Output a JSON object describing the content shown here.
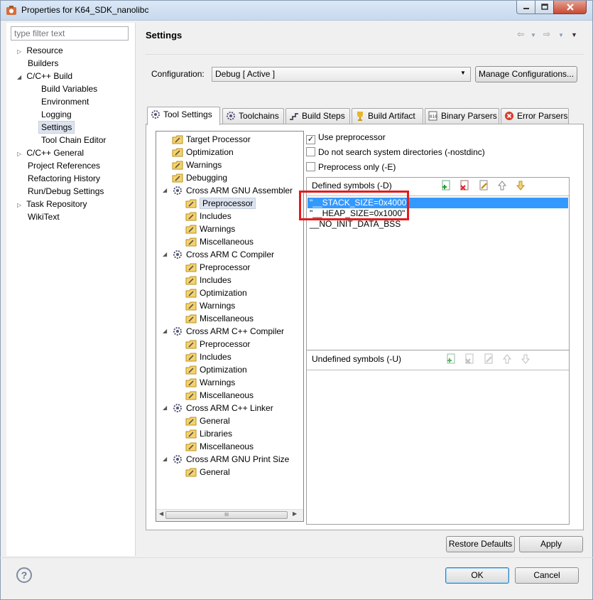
{
  "window": {
    "title": "Properties for K64_SDK_nanolibc"
  },
  "filter": {
    "placeholder": "type filter text"
  },
  "nav": [
    {
      "label": "Resource",
      "twisty": "▷"
    },
    {
      "label": "Builders",
      "twisty": ""
    },
    {
      "label": "C/C++ Build",
      "twisty": "◢"
    },
    {
      "label": "Build Variables",
      "twisty": ""
    },
    {
      "label": "Environment",
      "twisty": ""
    },
    {
      "label": "Logging",
      "twisty": ""
    },
    {
      "label": "Settings",
      "twisty": ""
    },
    {
      "label": "Tool Chain Editor",
      "twisty": ""
    },
    {
      "label": "C/C++ General",
      "twisty": "▷"
    },
    {
      "label": "Project References",
      "twisty": ""
    },
    {
      "label": "Refactoring History",
      "twisty": ""
    },
    {
      "label": "Run/Debug Settings",
      "twisty": ""
    },
    {
      "label": "Task Repository",
      "twisty": "▷"
    },
    {
      "label": "WikiText",
      "twisty": ""
    }
  ],
  "header": {
    "title": "Settings"
  },
  "configuration": {
    "label": "Configuration:",
    "value": "Debug  [ Active ]",
    "manage_label": "Manage Configurations..."
  },
  "tabs": [
    "Tool Settings",
    "Toolchains",
    "Build Steps",
    "Build Artifact",
    "Binary Parsers",
    "Error Parsers"
  ],
  "tool_tree": [
    "Target Processor",
    "Optimization",
    "Warnings",
    "Debugging",
    "Cross ARM GNU Assembler",
    "Preprocessor",
    "Includes",
    "Warnings",
    "Miscellaneous",
    "Cross ARM C Compiler",
    "Preprocessor",
    "Includes",
    "Optimization",
    "Warnings",
    "Miscellaneous",
    "Cross ARM C++ Compiler",
    "Preprocessor",
    "Includes",
    "Optimization",
    "Warnings",
    "Miscellaneous",
    "Cross ARM C++ Linker",
    "General",
    "Libraries",
    "Miscellaneous",
    "Cross ARM GNU Print Size",
    "General"
  ],
  "scroll_label": "III",
  "options": {
    "use_preprocessor": "Use preprocessor",
    "no_std_dirs": "Do not search system directories (-nostdinc)",
    "preprocess_only": "Preprocess only (-E)"
  },
  "defined": {
    "title": "Defined symbols (-D)",
    "items": [
      "\"__STACK_SIZE=0x4000\"",
      "\"__HEAP_SIZE=0x1000\"",
      "__NO_INIT_DATA_BSS"
    ]
  },
  "undefined": {
    "title": "Undefined symbols (-U)"
  },
  "buttons": {
    "restore": "Restore Defaults",
    "apply": "Apply",
    "ok": "OK",
    "cancel": "Cancel",
    "help": "?"
  },
  "colors": {
    "selection": "#3399ff",
    "highlight_box": "#e41b1b",
    "titlebar": "#dbe8f6"
  }
}
